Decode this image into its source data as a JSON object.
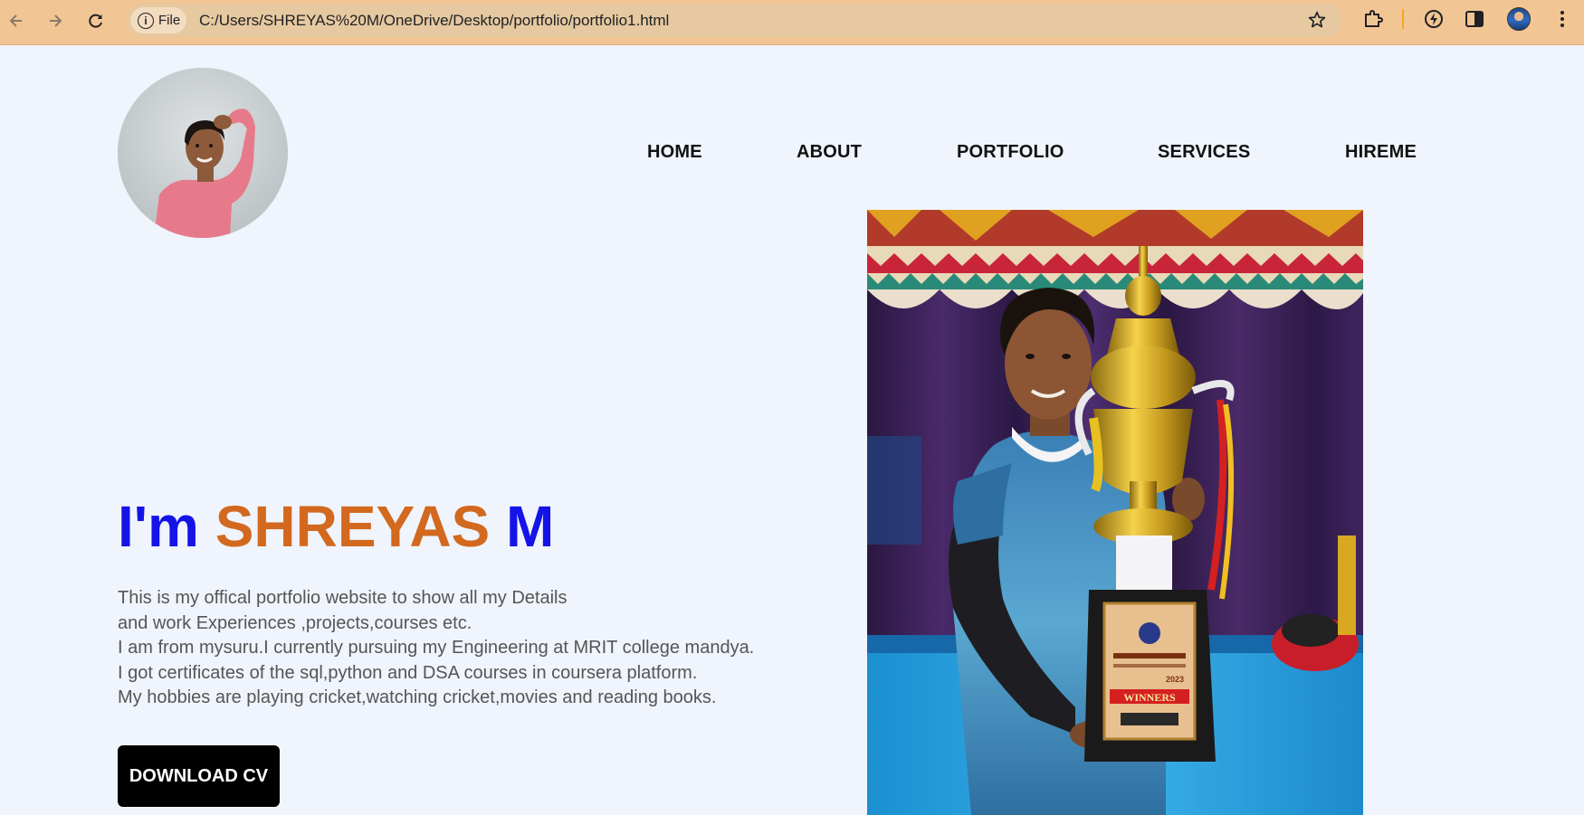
{
  "browser": {
    "site_info_label": "File",
    "url": "C:/Users/SHREYAS%20M/OneDrive/Desktop/portfolio/portfolio1.html",
    "accent_color": "#f2c594",
    "icons": [
      "back-arrow-icon",
      "forward-arrow-icon",
      "reload-icon",
      "info-icon",
      "star-icon",
      "extensions-icon",
      "performance-icon",
      "side-panel-icon",
      "profile-avatar",
      "kebab-menu-icon"
    ]
  },
  "nav": {
    "home": "HOME",
    "about": "ABOUT",
    "portfolio": "PORTFOLIO",
    "services": "SERVICES",
    "hireme": "HIREME"
  },
  "hero": {
    "prefix": "I'm",
    "first_name": "SHREYAS",
    "last_name": "M",
    "prefix_color": "#1414e8",
    "name_color": "#d2691e",
    "bio_lines": [
      "This is my offical portfolio website to show all my Details",
      "and work Experiences ,projects,courses etc.",
      "I am from mysuru.I currently pursuing my Engineering at MRIT college mandya.",
      "I got certificates of the sql,python and DSA courses in coursera platform.",
      "My hobbies are playing cricket,watching cricket,movies and reading books."
    ],
    "cv_button": "DOWNLOAD CV"
  },
  "trophy_plaque": {
    "title": "WINNERS",
    "year": "2023"
  }
}
